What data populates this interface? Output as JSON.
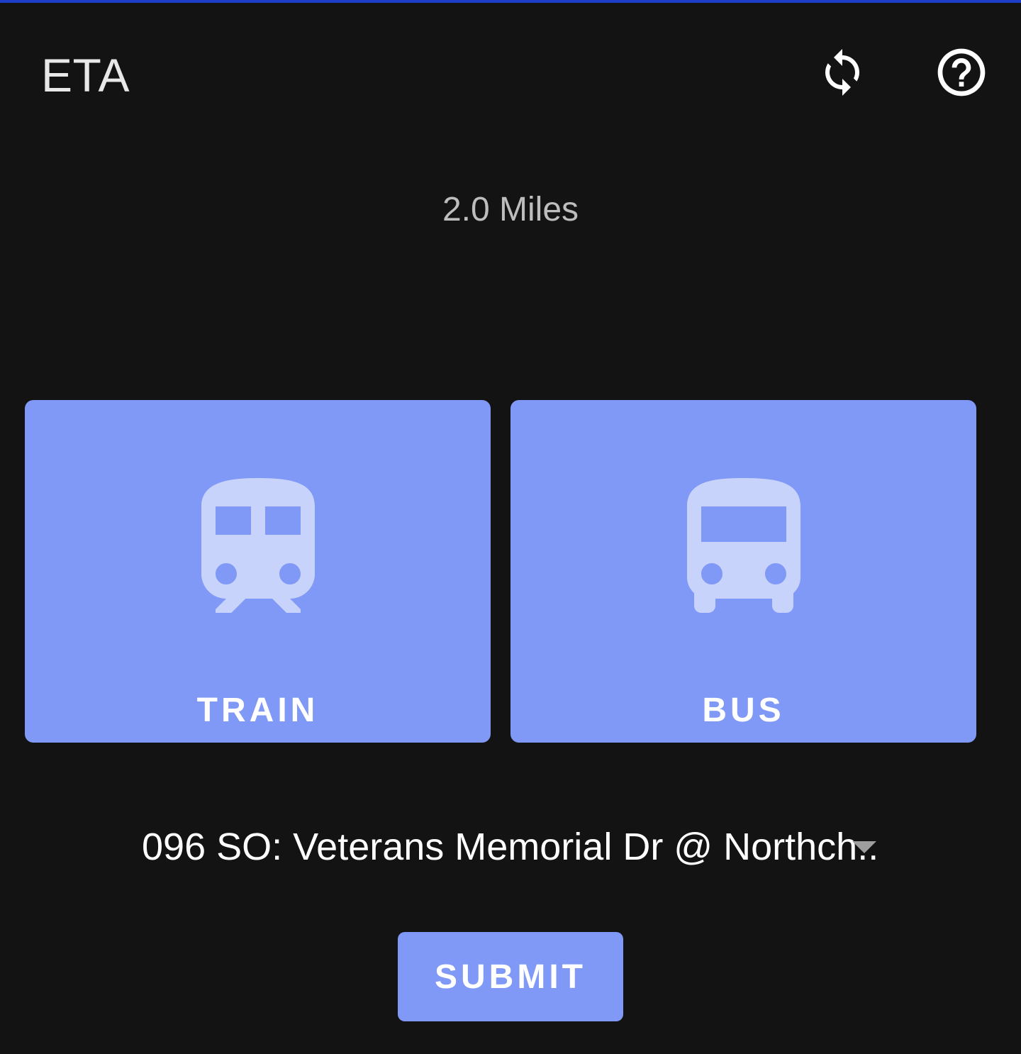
{
  "app": {
    "title": "ETA",
    "accent_color": "#1e3ec8",
    "background_color": "#131313"
  },
  "toolbar": {
    "refresh_icon": "refresh-icon",
    "help_icon": "help-icon"
  },
  "distance": {
    "text": "2.0 Miles"
  },
  "modes": [
    {
      "label": "TRAIN",
      "icon": "train-icon",
      "color": "#8199f6"
    },
    {
      "label": "BUS",
      "icon": "bus-icon",
      "color": "#8199f6"
    }
  ],
  "stop_select": {
    "selected_value": "096 SO: Veterans Memorial Dr @ Northch.."
  },
  "submit": {
    "label": "SUBMIT"
  }
}
